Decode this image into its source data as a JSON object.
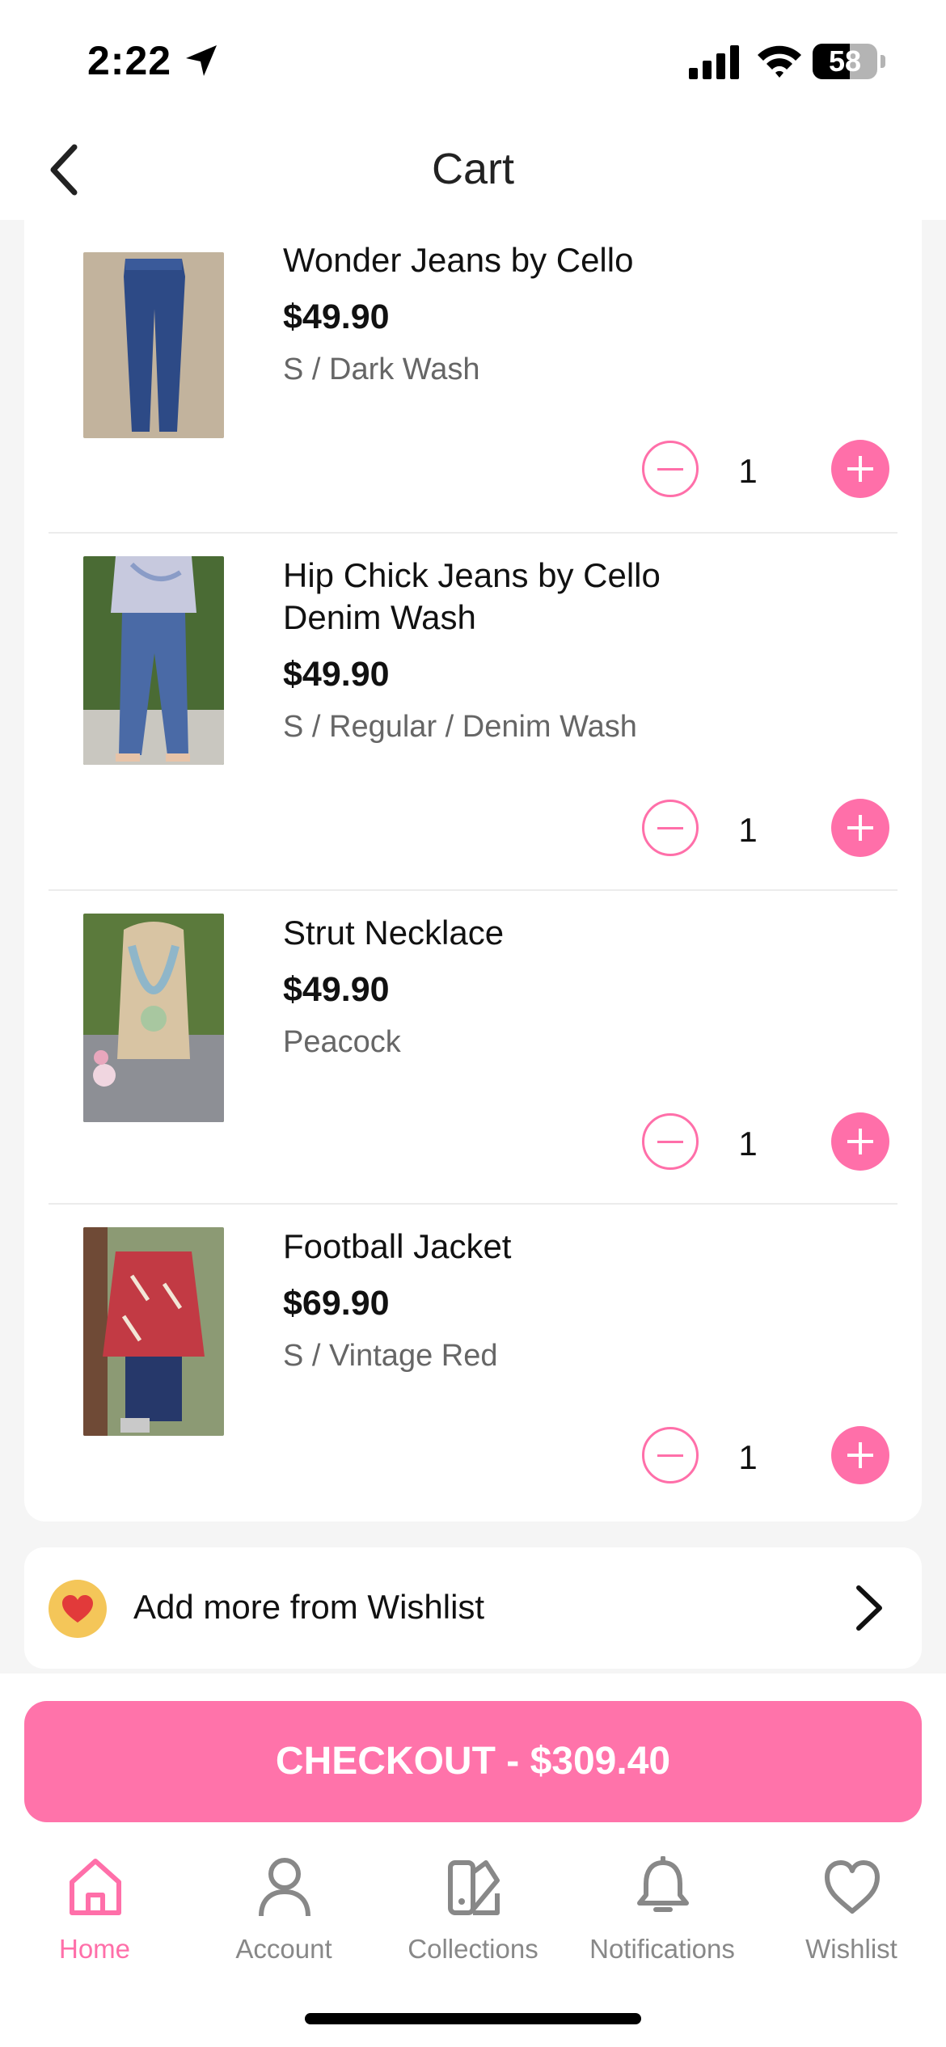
{
  "status_bar": {
    "time": "2:22",
    "battery": "58",
    "battery_level": 0.58
  },
  "header": {
    "title": "Cart"
  },
  "cart": {
    "items": [
      {
        "name": "Wonder Jeans by Cello",
        "price": "$49.90",
        "variant": "S / Dark Wash",
        "quantity": "1"
      },
      {
        "name": "Hip Chick Jeans by Cello Denim Wash",
        "price": "$49.90",
        "variant": "S / Regular / Denim Wash",
        "quantity": "1"
      },
      {
        "name": "Strut Necklace",
        "price": "$49.90",
        "variant": "Peacock",
        "quantity": "1"
      },
      {
        "name": "Football Jacket",
        "price": "$69.90",
        "variant": "S / Vintage Red",
        "quantity": "1"
      }
    ]
  },
  "wishlist_row": {
    "label": "Add more from Wishlist"
  },
  "checkout": {
    "label": "CHECKOUT - $309.40"
  },
  "tab_bar": {
    "tabs": [
      {
        "label": "Home",
        "icon": "home-icon",
        "active": true
      },
      {
        "label": "Account",
        "icon": "account-icon",
        "active": false
      },
      {
        "label": "Collections",
        "icon": "collections-icon",
        "active": false
      },
      {
        "label": "Notifications",
        "icon": "bell-icon",
        "active": false
      },
      {
        "label": "Wishlist",
        "icon": "heart-icon",
        "active": false
      }
    ]
  },
  "colors": {
    "accent": "#ff73aa",
    "text": "#111111",
    "muted": "#888888"
  }
}
